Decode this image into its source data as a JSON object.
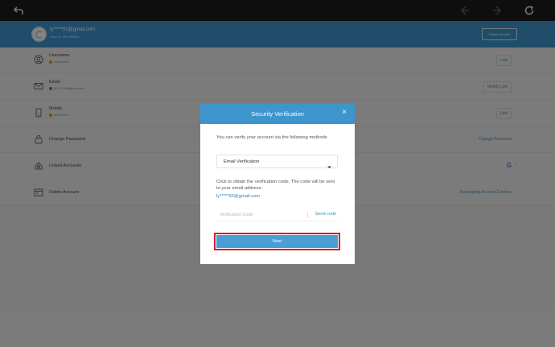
{
  "toolbar": {
    "back": "back-arrow-icon",
    "prev": "left-arrow-icon",
    "next": "right-arrow-icon",
    "refresh": "refresh-icon"
  },
  "account": {
    "email": "ly*****92@gmail.com",
    "view_id": "View ID: 201780904",
    "switch_label": "Switch account",
    "accent": "#3d95cc"
  },
  "rows": [
    {
      "icon": "user-icon",
      "title": "Username",
      "status": "Not linked",
      "status_color": "#f08a24",
      "action": "Link"
    },
    {
      "icon": "email-icon",
      "title": "Email",
      "status": "ly*****92@gmail.com",
      "status_color": "#2ea44f",
      "action": "Modify Link"
    },
    {
      "icon": "mobile-icon",
      "title": "Mobile",
      "status": "Not linked",
      "status_color": "#f08a24",
      "action": "Link"
    },
    {
      "icon": "lock-icon",
      "title": "Change Password",
      "action": "Change Password"
    },
    {
      "icon": "linked-accounts-icon",
      "title": "Linked Accounts",
      "action": "G"
    },
    {
      "icon": "delete-account-icon",
      "title": "Delete Account",
      "action": "Requesting Account Deletion"
    }
  ],
  "modal": {
    "title": "Security Verification",
    "close": "×",
    "description": "You can verify your account via the following methods",
    "method_selected": "Email Verification",
    "info": "Click to obtain the verification code. The code will be sent to your email address.",
    "email": "ly*****92@gmail.com",
    "code_placeholder": "Verification Code",
    "send_code_label": "Send code",
    "next_label": "Next",
    "highlight_color": "#d11f2f"
  }
}
